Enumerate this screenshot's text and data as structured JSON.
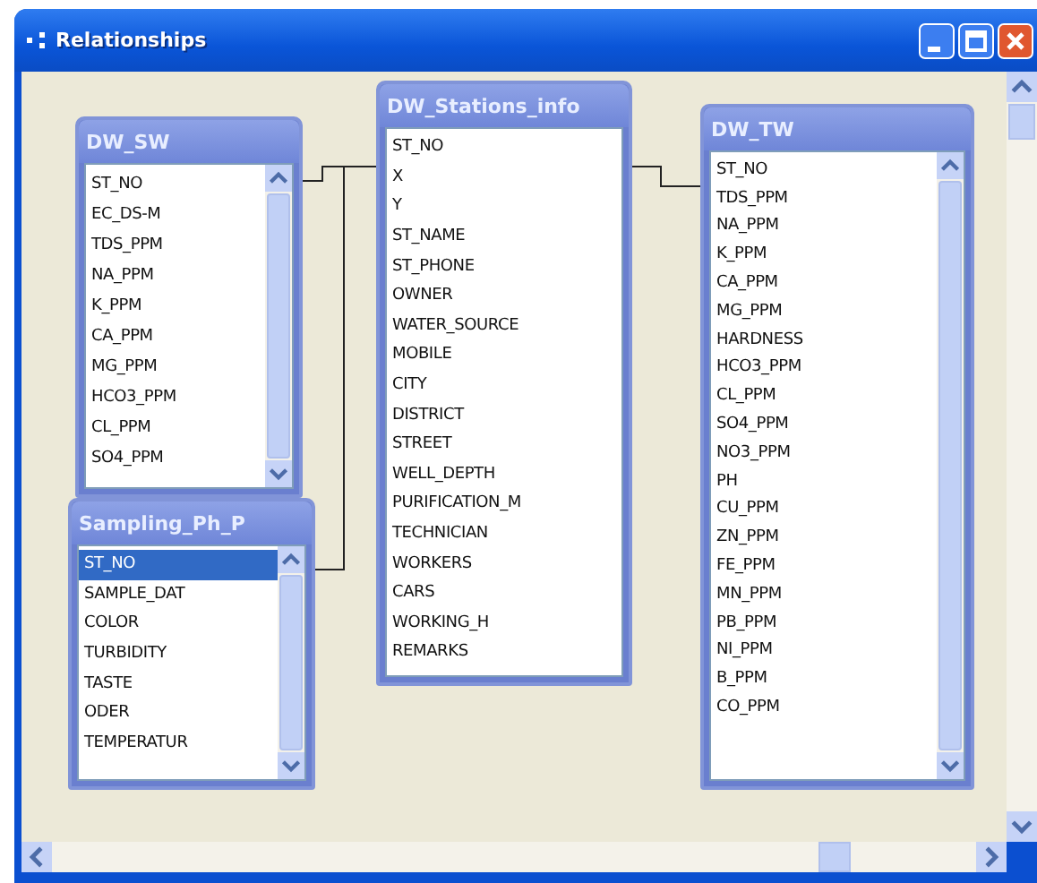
{
  "window": {
    "title": "Relationships"
  },
  "tables": [
    {
      "name": "DW_SW",
      "fields": [
        {
          "label": "ST_NO",
          "selected": false
        },
        {
          "label": "EC_DS-M",
          "selected": false
        },
        {
          "label": "TDS_PPM",
          "selected": false
        },
        {
          "label": "NA_PPM",
          "selected": false
        },
        {
          "label": "K_PPM",
          "selected": false
        },
        {
          "label": "CA_PPM",
          "selected": false
        },
        {
          "label": "MG_PPM",
          "selected": false
        },
        {
          "label": "HCO3_PPM",
          "selected": false
        },
        {
          "label": "CL_PPM",
          "selected": false
        },
        {
          "label": "SO4_PPM",
          "selected": false
        }
      ]
    },
    {
      "name": "Sampling_Ph_P",
      "fields": [
        {
          "label": "ST_NO",
          "selected": true
        },
        {
          "label": "SAMPLE_DAT",
          "selected": false
        },
        {
          "label": "COLOR",
          "selected": false
        },
        {
          "label": "TURBIDITY",
          "selected": false
        },
        {
          "label": "TASTE",
          "selected": false
        },
        {
          "label": "ODER",
          "selected": false
        },
        {
          "label": "TEMPERATUR",
          "selected": false
        }
      ]
    },
    {
      "name": "DW_Stations_info",
      "fields": [
        {
          "label": "ST_NO",
          "selected": false
        },
        {
          "label": "X",
          "selected": false
        },
        {
          "label": "Y",
          "selected": false
        },
        {
          "label": "ST_NAME",
          "selected": false
        },
        {
          "label": "ST_PHONE",
          "selected": false
        },
        {
          "label": "OWNER",
          "selected": false
        },
        {
          "label": "WATER_SOURCE",
          "selected": false
        },
        {
          "label": "MOBILE",
          "selected": false
        },
        {
          "label": "CITY",
          "selected": false
        },
        {
          "label": "DISTRICT",
          "selected": false
        },
        {
          "label": "STREET",
          "selected": false
        },
        {
          "label": "WELL_DEPTH",
          "selected": false
        },
        {
          "label": "PURIFICATION_M",
          "selected": false
        },
        {
          "label": "TECHNICIAN",
          "selected": false
        },
        {
          "label": "WORKERS",
          "selected": false
        },
        {
          "label": "CARS",
          "selected": false
        },
        {
          "label": "WORKING_H",
          "selected": false
        },
        {
          "label": "REMARKS",
          "selected": false
        }
      ]
    },
    {
      "name": "DW_TW",
      "fields": [
        {
          "label": "ST_NO",
          "selected": false
        },
        {
          "label": "TDS_PPM",
          "selected": false
        },
        {
          "label": "NA_PPM",
          "selected": false
        },
        {
          "label": "K_PPM",
          "selected": false
        },
        {
          "label": "CA_PPM",
          "selected": false
        },
        {
          "label": "MG_PPM",
          "selected": false
        },
        {
          "label": "HARDNESS",
          "selected": false
        },
        {
          "label": "HCO3_PPM",
          "selected": false
        },
        {
          "label": "CL_PPM",
          "selected": false
        },
        {
          "label": "SO4_PPM",
          "selected": false
        },
        {
          "label": "NO3_PPM",
          "selected": false
        },
        {
          "label": "PH",
          "selected": false
        },
        {
          "label": "CU_PPM",
          "selected": false
        },
        {
          "label": "ZN_PPM",
          "selected": false
        },
        {
          "label": "FE_PPM",
          "selected": false
        },
        {
          "label": "MN_PPM",
          "selected": false
        },
        {
          "label": "PB_PPM",
          "selected": false
        },
        {
          "label": "NI_PPM",
          "selected": false
        },
        {
          "label": "B_PPM",
          "selected": false
        },
        {
          "label": "CO_PPM",
          "selected": false
        }
      ]
    }
  ]
}
